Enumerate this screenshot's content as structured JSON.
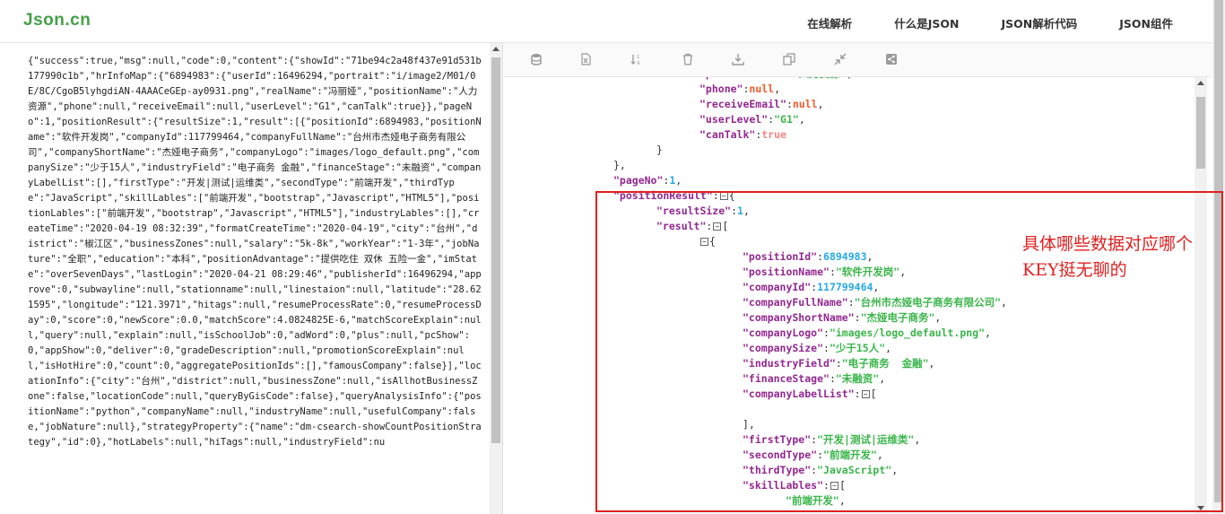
{
  "header": {
    "logo": "Json.cn",
    "nav": [
      "在线解析",
      "什么是JSON",
      "JSON解析代码",
      "JSON组件"
    ]
  },
  "left_panel": {
    "raw_text": "{\"success\":true,\"msg\":null,\"code\":0,\"content\":{\"showId\":\"71be94c2a48f437e91d531b177990c1b\",\"hrInfoMap\":{\"6894983\":{\"userId\":16496294,\"portrait\":\"i/image2/M01/0E/8C/CgoB5lyhgdiAN-4AAACeGEp-ay0931.png\",\"realName\":\"冯丽娅\",\"positionName\":\"人力资源\",\"phone\":null,\"receiveEmail\":null,\"userLevel\":\"G1\",\"canTalk\":true}},\"pageNo\":1,\"positionResult\":{\"resultSize\":1,\"result\":[{\"positionId\":6894983,\"positionName\":\"软件开发岗\",\"companyId\":117799464,\"companyFullName\":\"台州市杰娅电子商务有限公司\",\"companyShortName\":\"杰娅电子商务\",\"companyLogo\":\"images/logo_default.png\",\"companySize\":\"少于15人\",\"industryField\":\"电子商务 金融\",\"financeStage\":\"未融资\",\"companyLabelList\":[],\"firstType\":\"开发|测试|运维类\",\"secondType\":\"前端开发\",\"thirdType\":\"JavaScript\",\"skillLables\":[\"前端开发\",\"bootstrap\",\"Javascript\",\"HTML5\"],\"positionLables\":[\"前端开发\",\"bootstrap\",\"Javascript\",\"HTML5\"],\"industryLables\":[],\"createTime\":\"2020-04-19 08:32:39\",\"formatCreateTime\":\"2020-04-19\",\"city\":\"台州\",\"district\":\"椒江区\",\"businessZones\":null,\"salary\":\"5k-8k\",\"workYear\":\"1-3年\",\"jobNature\":\"全职\",\"education\":\"本科\",\"positionAdvantage\":\"提供吃住 双休 五险一金\",\"imState\":\"overSevenDays\",\"lastLogin\":\"2020-04-21 08:29:46\",\"publisherId\":16496294,\"approve\":0,\"subwayline\":null,\"stationname\":null,\"linestaion\":null,\"latitude\":\"28.621595\",\"longitude\":\"121.3971\",\"hitags\":null,\"resumeProcessRate\":0,\"resumeProcessDay\":0,\"score\":0,\"newScore\":0.0,\"matchScore\":4.0824825E-6,\"matchScoreExplain\":null,\"query\":null,\"explain\":null,\"isSchoolJob\":0,\"adWord\":0,\"plus\":null,\"pcShow\":0,\"appShow\":0,\"deliver\":0,\"gradeDescription\":null,\"promotionScoreExplain\":null,\"isHotHire\":0,\"count\":0,\"aggregatePositionIds\":[],\"famousCompany\":false}],\"locationInfo\":{\"city\":\"台州\",\"district\":null,\"businessZone\":null,\"isAllhotBusinessZone\":false,\"locationCode\":null,\"queryByGisCode\":false},\"queryAnalysisInfo\":{\"positionName\":\"python\",\"companyName\":null,\"industryName\":null,\"usefulCompany\":false,\"jobNature\":null},\"strategyProperty\":{\"name\":\"dm-csearch-showCountPositionStrategy\",\"id\":0},\"hotLabels\":null,\"hiTags\":null,\"industryField\":nu"
  },
  "tree": {
    "l01_key": "\"phone\"",
    "l01_val": "null",
    "l02_key": "\"receiveEmail\"",
    "l02_val": "null",
    "l03_key": "\"userLevel\"",
    "l03_val": "\"G1\"",
    "l04_key": "\"canTalk\"",
    "l04_val": "true",
    "l07_key": "\"pageNo\"",
    "l07_val": "1",
    "l08_key": "\"positionResult\"",
    "l09_key": "\"resultSize\"",
    "l09_val": "1",
    "l10_key": "\"result\"",
    "l12_key": "\"positionId\"",
    "l12_val": "6894983",
    "l13_key": "\"positionName\"",
    "l13_val": "\"软件开发岗\"",
    "l14_key": "\"companyId\"",
    "l14_val": "117799464",
    "l15_key": "\"companyFullName\"",
    "l15_val": "\"台州市杰娅电子商务有限公司\"",
    "l16_key": "\"companyShortName\"",
    "l16_val": "\"杰娅电子商务\"",
    "l17_key": "\"companyLogo\"",
    "l17_val": "\"images/logo_default.png\"",
    "l18_key": "\"companySize\"",
    "l18_val": "\"少于15人\"",
    "l19_key": "\"industryField\"",
    "l19_val": "\"电子商务  金融\"",
    "l20_key": "\"financeStage\"",
    "l20_val": "\"未融资\"",
    "l21_key": "\"companyLabelList\"",
    "l23_key": "\"firstType\"",
    "l23_val": "\"开发|测试|运维类\"",
    "l24_key": "\"secondType\"",
    "l24_val": "\"前端开发\"",
    "l25_key": "\"thirdType\"",
    "l25_val": "\"JavaScript\"",
    "l26_key": "\"skillLables\"",
    "l27_val": "\"前端开发\""
  },
  "annotation": {
    "text": "具体哪些数据对应哪个KEY挺无聊的",
    "color": "#e02020"
  },
  "colors": {
    "key": "#92278f",
    "string": "#3ab54a",
    "number": "#25aae2",
    "bool": "#f98280",
    "null": "#f1592a",
    "logo": "#43a047"
  },
  "icons": [
    "database-icon",
    "excel-icon",
    "sort-icon",
    "trash-icon",
    "download-icon",
    "copy-icon",
    "compress-icon",
    "share-icon"
  ]
}
